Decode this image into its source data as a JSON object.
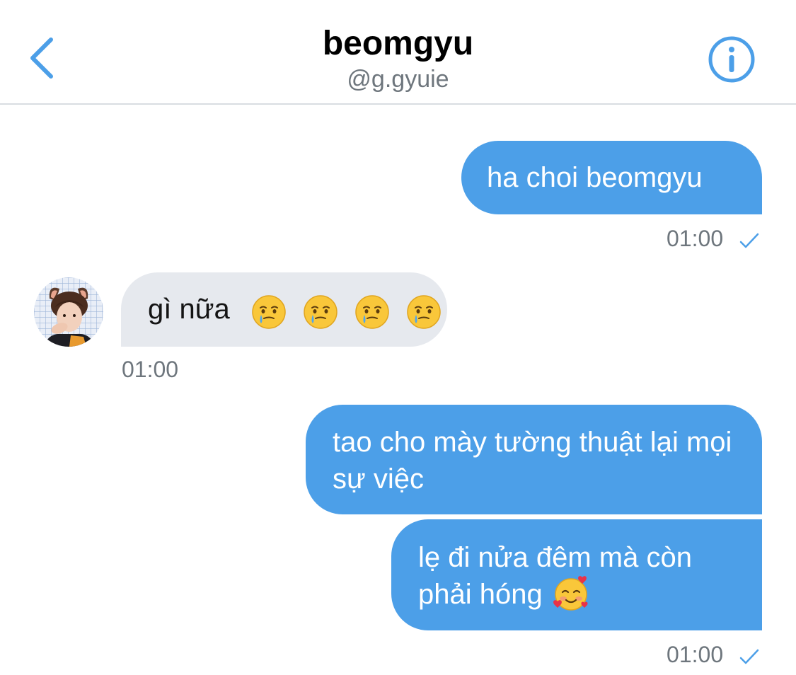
{
  "header": {
    "title": "beomgyu",
    "handle": "@g.gyuie",
    "accent_color": "#4c9fe8",
    "back_icon": "chevron-left-icon",
    "info_icon": "info-icon"
  },
  "messages": [
    {
      "direction": "outgoing",
      "text": "ha choi beomgyu",
      "time": "01:00",
      "read_icon": "checkmark-icon"
    },
    {
      "direction": "incoming",
      "text": "gì nữa",
      "emojis": [
        "face-holding-back-tears-emoji",
        "face-holding-back-tears-emoji",
        "face-holding-back-tears-emoji",
        "face-holding-back-tears-emoji"
      ],
      "time": "01:00",
      "avatar": "avatar"
    },
    {
      "direction": "outgoing",
      "text": "tao cho mày tường thuật lại mọi sự việc"
    },
    {
      "direction": "outgoing",
      "text": "lẹ đi nửa đêm mà còn phải hóng",
      "emoji": "smiling-face-with-hearts-emoji",
      "time": "01:00",
      "read_icon": "checkmark-icon"
    }
  ],
  "colors": {
    "outgoing_bubble": "#4c9fe8",
    "incoming_bubble": "#e6e9ee",
    "timestamp": "#6e767d"
  }
}
